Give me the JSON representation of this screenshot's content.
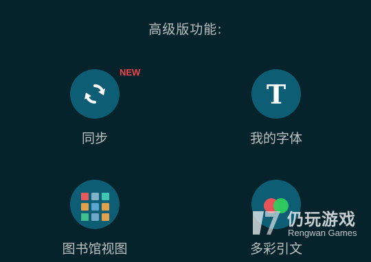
{
  "section_title": "高级版功能:",
  "features": [
    {
      "label": "同步",
      "icon": "sync-icon",
      "badge": "NEW"
    },
    {
      "label": "我的字体",
      "icon": "font-t-icon",
      "glyph": "T"
    },
    {
      "label": "图书馆视图",
      "icon": "library-grid-icon"
    },
    {
      "label": "多彩引文",
      "icon": "colorful-quote-icon"
    }
  ],
  "watermark": {
    "brand": "仍玩游戏",
    "sub": "Rengwan Games"
  },
  "colors": {
    "background": "#06222a",
    "icon_circle": "#0d5d74",
    "badge_red": "#f0464b",
    "text": "#b9c1c3"
  }
}
